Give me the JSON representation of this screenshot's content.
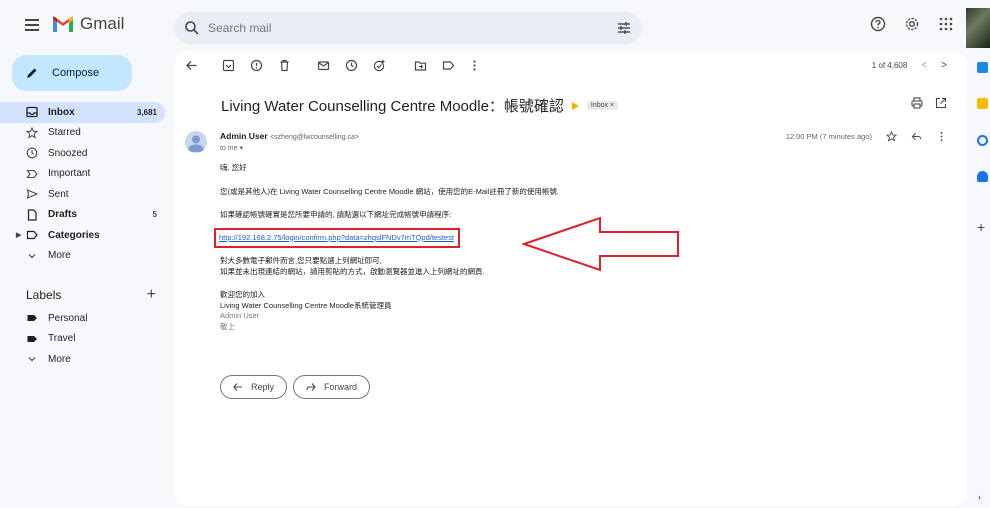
{
  "app": {
    "name": "Gmail"
  },
  "search": {
    "placeholder": "Search mail"
  },
  "compose": {
    "label": "Compose"
  },
  "nav": [
    {
      "label": "Inbox",
      "count": "3,681"
    },
    {
      "label": "Starred",
      "count": ""
    },
    {
      "label": "Snoozed",
      "count": ""
    },
    {
      "label": "Important",
      "count": ""
    },
    {
      "label": "Sent",
      "count": ""
    },
    {
      "label": "Drafts",
      "count": "5"
    },
    {
      "label": "Categories",
      "count": ""
    },
    {
      "label": "More",
      "count": ""
    }
  ],
  "labels": {
    "heading": "Labels",
    "plus": "+",
    "items": [
      {
        "label": "Personal"
      },
      {
        "label": "Travel"
      },
      {
        "label": "More"
      }
    ]
  },
  "pager": {
    "text": "1 of 4,608",
    "prev": "<",
    "next": ">"
  },
  "email": {
    "subject": "Living Water Counselling Centre Moodle：帳號確認",
    "chip": "Inbox ×",
    "sender_name": "Admin User",
    "sender_email": "<szheng@lwcounselling.ca>",
    "to": "to me ▾",
    "time": "12:00 PM (7 minutes ago)",
    "body": {
      "greeting": "嗨, 您好",
      "line1": "您(或是其他人)在 Living Water Counselling Centre Moodle 網站，使用您的E-Mail註冊了新的使用帳號.",
      "line2": "如果確認帳號確實是您所要申請的, 請點選以下網址完成帳號申請程序:",
      "link": "http://192.168.2.75/login/confirm.php?data=zhqslFNDv7mTQpd/testest",
      "line3": "對大多數電子郵件而言,您只要點選上列網址即可,",
      "line4": "如果並未出現連結的網站，請用剪貼的方式，啟動瀏覽器並進入上列網址的網頁.",
      "line5": "歡迎您的加入",
      "line6": "Living Water Counselling Centre Moodle系統管理員",
      "line7": "Admin User",
      "line8": "敬上"
    },
    "reply_label": "Reply",
    "forward_label": "Forward"
  },
  "colors": {
    "accent": "#c2e7ff",
    "active_nav": "#d3e3fd",
    "annotation_red": "#d9222a",
    "link": "#1a5fc7"
  }
}
